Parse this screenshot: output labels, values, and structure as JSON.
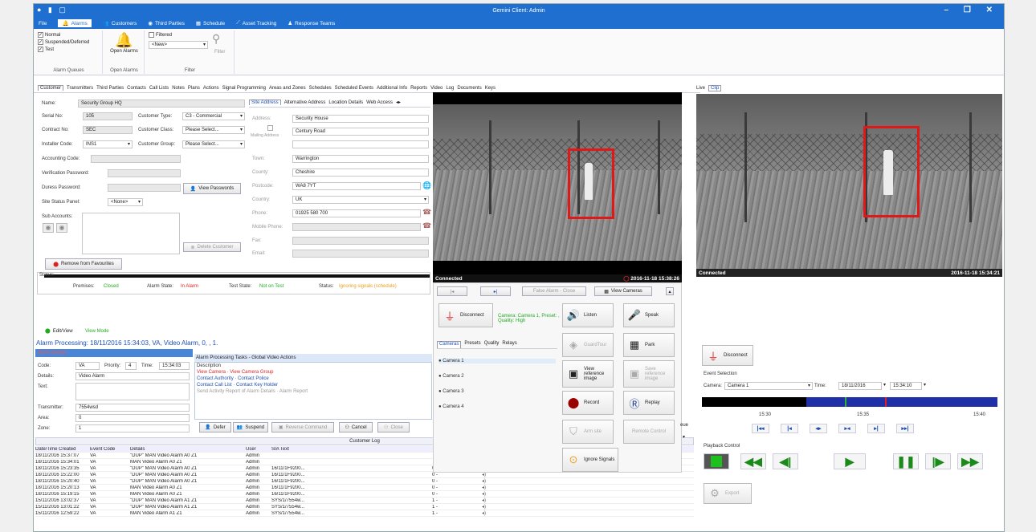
{
  "window": {
    "title": "Gemini Client: Admin",
    "controls": "– ❐ ✕"
  },
  "menu": {
    "file": "File",
    "items": [
      "Alarms",
      "Customers",
      "Third Parties",
      "Schedule",
      "Asset Tracking",
      "Response Teams"
    ]
  },
  "ribbon": {
    "queues": [
      "Normal",
      "Suspended/Deferred",
      "Test"
    ],
    "open_alarms": "Open Alarms",
    "filtered": "Filtered",
    "new_select": "<New>",
    "filter": "Filter",
    "group_labels": [
      "Alarm Queues",
      "Open Alarms",
      "Filter"
    ]
  },
  "tabs": [
    "Customer",
    "Transmitters",
    "Third Parties",
    "Contacts",
    "Call Lists",
    "Notes",
    "Plans",
    "Actions",
    "Signal Programming",
    "Areas and Zones",
    "Schedules",
    "Scheduled Events",
    "Additional Info",
    "Reports",
    "Video",
    "Log",
    "Documents",
    "Keys"
  ],
  "customer": {
    "name_label": "Name:",
    "name": "Security Group HQ",
    "serial_label": "Serial No:",
    "serial": "105",
    "type_label": "Customer Type:",
    "type": "C3 - Commercial",
    "contract_label": "Contract No:",
    "contract": "SEC",
    "class_label": "Customer Class:",
    "class": "Please Select...",
    "installer_label": "Installer Code:",
    "installer": "INS1",
    "group_label": "Customer Group:",
    "group": "Please Select...",
    "accounting_label": "Accounting Code:",
    "verification_label": "Verification Password:",
    "duress_label": "Duress Password:",
    "view_passwords": "View Passwords",
    "site_status_label": "Site Status Panel:",
    "site_status": "<None>",
    "sub_accounts_label": "Sub Accounts:",
    "delete_customer": "Delete Customer",
    "remove_fav": "Remove from Favourites"
  },
  "address": {
    "tabs": [
      "Site Address",
      "Alternative Address",
      "Location Details",
      "Web Access"
    ],
    "address_label": "Address:",
    "addr1": "Security House",
    "mailing_label": "Mailing Address",
    "addr2": "Century Road",
    "town_label": "Town:",
    "town": "Warrington",
    "county_label": "County:",
    "county": "Cheshire",
    "postcode_label": "Postcode:",
    "postcode": "WA8 7YT",
    "country_label": "Country:",
    "country": "UK",
    "phone_label": "Phone:",
    "phone": "01925 580 700",
    "mobile_label": "Mobile Phone:",
    "fax_label": "Fax:",
    "email_label": "Email:"
  },
  "status": {
    "label": "Status:",
    "premises_label": "Premises:",
    "premises": "Closed",
    "alarm_state_label": "Alarm State:",
    "alarm_state": "In Alarm",
    "test_state_label": "Test State:",
    "test_state": "Not on Test",
    "status_label": "Status:",
    "status": "Ignoring signals (schedule)"
  },
  "alarm": {
    "editview": "Edit/View",
    "viewmode": "View Mode",
    "processing": "Alarm Processing:  18/11/2016 15:34:03, VA, Video Alarm, 0, , 1.",
    "details_title": "Alarm Details",
    "code_label": "Code:",
    "code": "VA",
    "priority_label": "Priority:",
    "priority": "4",
    "time_label": "Time:",
    "time": "15:34:03",
    "details_label": "Details:",
    "details": "Video Alarm",
    "text_label": "Text:",
    "transmitter_label": "Transmitter:",
    "transmitter": "7554wsd",
    "area_label": "Area:",
    "area": "0",
    "zone_label": "Zone:",
    "zone": "1"
  },
  "tasks": {
    "title": "Alarm Processing Tasks - Global Video Actions",
    "header": "Description",
    "rows": [
      [
        "View Camera",
        "View Camera Group"
      ],
      [
        "Contact Authority",
        "Contact Police"
      ],
      [
        "Contact Call List",
        "Contact Key Holder"
      ],
      [
        "Send Activity Report of Alarm Details",
        "Alarm Report"
      ]
    ],
    "buttons": [
      "Defer",
      "Suspend",
      "Reverse Command",
      "Cancel",
      "Close"
    ]
  },
  "log": {
    "title": "Customer Log",
    "headers": [
      "Date/Time Created",
      "Event Code",
      "Details",
      "User",
      "SIA Text"
    ],
    "rows": [
      [
        "18/11/2016 15:37:07",
        "VA",
        "\"DUP\" MAN Video Alarm A0 Z1",
        "Admin",
        "",
        ""
      ],
      [
        "18/11/2016 15:34:01",
        "VA",
        "MAN Video Alarm A0 Z1",
        "Admin",
        "",
        ""
      ],
      [
        "18/11/2016 15:23:35",
        "VA",
        "\"DUP\" MAN Video Alarm A0 Z1",
        "Admin",
        "16/11/1F9200...",
        "0 -"
      ],
      [
        "18/11/2016 15:22:00",
        "VA",
        "\"DUP\" MAN Video Alarm A0 Z1",
        "Admin",
        "16/11/1F9200...",
        "0 -"
      ],
      [
        "18/11/2016 15:20:40",
        "VA",
        "\"DUP\" MAN Video Alarm A0 Z1",
        "Admin",
        "16/11/1F9200...",
        "0 -"
      ],
      [
        "18/11/2016 15:20:13",
        "VA",
        "MAN Video Alarm A0 Z1",
        "Admin",
        "16/11/1F9200...",
        "0 -"
      ],
      [
        "18/11/2016 15:19:15",
        "VA",
        "MAN Video Alarm A0 Z1",
        "Admin",
        "16/11/1F9200...",
        "0 -"
      ],
      [
        "15/11/2016 13:02:37",
        "VA",
        "\"DUP\" MAN Video Alarm A1 Z1",
        "Admin",
        "SYS/1/7554w...",
        "1 -"
      ],
      [
        "15/11/2016 13:01:22",
        "VA",
        "\"DUP\" MAN Video Alarm A1 Z1",
        "Admin",
        "SYS/1/7554w...",
        "1 -"
      ],
      [
        "15/11/2016 12:59:22",
        "VA",
        "MAN Video Alarm A1 Z1",
        "Admin",
        "SYS/1/7554w...",
        "1 -"
      ]
    ]
  },
  "live": {
    "connected": "Connected",
    "timestamp": "2016-11-18 15:38:26",
    "false_alarm": "False Alarm - Close",
    "view_cameras": "View Cameras",
    "disconnect": "Disconnect",
    "camera_info": "Camera: Camera 1, Preset: , Quality: High",
    "tabs": [
      "Cameras",
      "Presets",
      "Quality",
      "Relays"
    ],
    "cameras": [
      "Camera 1",
      "Camera 2",
      "Camera 3",
      "Camera 4"
    ],
    "actions": [
      "Listen",
      "Speak",
      "GuardTour",
      "Park",
      "View reference image",
      "Save reference image",
      "Record",
      "Replay",
      "Arm site",
      "Remote Control",
      "Ignore Signals"
    ]
  },
  "clip": {
    "tabs": [
      "Live",
      "Clip"
    ],
    "connected": "Connected",
    "timestamp": "2016-11-18 15:34:21",
    "disconnect": "Disconnect",
    "event_selection": "Event Selection",
    "camera_label": "Camera:",
    "camera": "Camera 1",
    "time_label": "Time:",
    "date": "18/11/2016",
    "time": "15:34:10",
    "ticks": [
      "15:30",
      "15:35",
      "15:40"
    ],
    "playback": "Playback Control",
    "export": "Export",
    "queue": "eue"
  }
}
